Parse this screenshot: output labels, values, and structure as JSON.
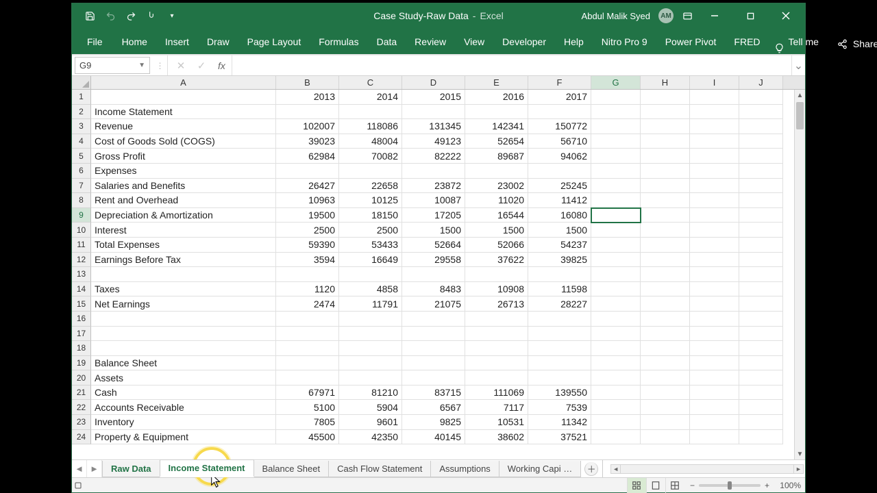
{
  "titlebar": {
    "doc_name": "Case Study-Raw Data",
    "app_name": "Excel",
    "user_name": "Abdul Malik Syed",
    "user_initials": "AM"
  },
  "ribbon": {
    "tabs": [
      "File",
      "Home",
      "Insert",
      "Draw",
      "Page Layout",
      "Formulas",
      "Data",
      "Review",
      "View",
      "Developer",
      "Help",
      "Nitro Pro 9",
      "Power Pivot",
      "FRED"
    ],
    "tell_me": "Tell me",
    "share": "Share"
  },
  "namebox": {
    "ref": "G9"
  },
  "columns": [
    "A",
    "B",
    "C",
    "D",
    "E",
    "F",
    "G",
    "H",
    "I",
    "J"
  ],
  "active_col_index": 6,
  "active_row_index": 8,
  "chart_data": {
    "type": "table",
    "title": "Income Statement & Balance Sheet raw data",
    "years": [
      2013,
      2014,
      2015,
      2016,
      2017
    ],
    "rows": [
      {
        "r": 1,
        "label": "",
        "vals": [
          2013,
          2014,
          2015,
          2016,
          2017
        ]
      },
      {
        "r": 2,
        "label": "Income Statement",
        "vals": [
          "",
          "",
          "",
          "",
          ""
        ]
      },
      {
        "r": 3,
        "label": "Revenue",
        "vals": [
          102007,
          118086,
          131345,
          142341,
          150772
        ]
      },
      {
        "r": 4,
        "label": "Cost of Goods Sold (COGS)",
        "vals": [
          39023,
          48004,
          49123,
          52654,
          56710
        ]
      },
      {
        "r": 5,
        "label": "Gross Profit",
        "vals": [
          62984,
          70082,
          82222,
          89687,
          94062
        ]
      },
      {
        "r": 6,
        "label": "Expenses",
        "vals": [
          "",
          "",
          "",
          "",
          ""
        ]
      },
      {
        "r": 7,
        "label": "Salaries and Benefits",
        "vals": [
          26427,
          22658,
          23872,
          23002,
          25245
        ]
      },
      {
        "r": 8,
        "label": "Rent and Overhead",
        "vals": [
          10963,
          10125,
          10087,
          11020,
          11412
        ]
      },
      {
        "r": 9,
        "label": "Depreciation & Amortization",
        "vals": [
          19500,
          18150,
          17205,
          16544,
          16080
        ]
      },
      {
        "r": 10,
        "label": "Interest",
        "vals": [
          2500,
          2500,
          1500,
          1500,
          1500
        ]
      },
      {
        "r": 11,
        "label": "Total Expenses",
        "vals": [
          59390,
          53433,
          52664,
          52066,
          54237
        ]
      },
      {
        "r": 12,
        "label": "Earnings Before Tax",
        "vals": [
          3594,
          16649,
          29558,
          37622,
          39825
        ]
      },
      {
        "r": 13,
        "label": "",
        "vals": [
          "",
          "",
          "",
          "",
          ""
        ]
      },
      {
        "r": 14,
        "label": "Taxes",
        "vals": [
          1120,
          4858,
          8483,
          10908,
          11598
        ]
      },
      {
        "r": 15,
        "label": "Net Earnings",
        "vals": [
          2474,
          11791,
          21075,
          26713,
          28227
        ]
      },
      {
        "r": 16,
        "label": "",
        "vals": [
          "",
          "",
          "",
          "",
          ""
        ]
      },
      {
        "r": 17,
        "label": "",
        "vals": [
          "",
          "",
          "",
          "",
          ""
        ]
      },
      {
        "r": 18,
        "label": "",
        "vals": [
          "",
          "",
          "",
          "",
          ""
        ]
      },
      {
        "r": 19,
        "label": "Balance Sheet",
        "vals": [
          "",
          "",
          "",
          "",
          ""
        ]
      },
      {
        "r": 20,
        "label": "Assets",
        "vals": [
          "",
          "",
          "",
          "",
          ""
        ]
      },
      {
        "r": 21,
        "label": "Cash",
        "vals": [
          67971,
          81210,
          83715,
          111069,
          139550
        ]
      },
      {
        "r": 22,
        "label": "Accounts Receivable",
        "vals": [
          5100,
          5904,
          6567,
          7117,
          7539
        ]
      },
      {
        "r": 23,
        "label": "Inventory",
        "vals": [
          7805,
          9601,
          9825,
          10531,
          11342
        ]
      },
      {
        "r": 24,
        "label": "Property & Equipment",
        "vals": [
          45500,
          42350,
          40145,
          38602,
          37521
        ]
      }
    ]
  },
  "sheet_tabs": [
    "Raw Data",
    "Income Statement",
    "Balance Sheet",
    "Cash Flow Statement",
    "Assumptions",
    "Working Capi …"
  ],
  "active_sheet_tab": 1,
  "green_sheet_tab": 0,
  "zoom": "100%"
}
